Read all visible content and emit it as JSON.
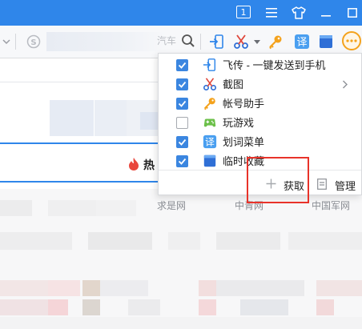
{
  "titlebar": {
    "badge_count": "1",
    "menu_icon": "hamburger-icon",
    "skin_icon": "tshirt-icon",
    "minimize_icon": "minimize-icon",
    "maximize_icon": "maximize-icon"
  },
  "toolbar": {
    "search_partial_text": "汽车",
    "tools": [
      "send-to-phone-icon",
      "screenshot-scissors-icon",
      "key-icon",
      "translate-icon",
      "favorites-icon",
      "more-icon"
    ]
  },
  "page": {
    "hot_label": "热",
    "links": [
      "求是网",
      "中青网",
      "中国军网"
    ]
  },
  "menu": {
    "items": [
      {
        "label": "飞传 - 一键发送到手机",
        "checked": true,
        "icon": "send-to-phone-icon"
      },
      {
        "label": "截图",
        "checked": true,
        "icon": "scissors-icon",
        "has_submenu": true
      },
      {
        "label": "帐号助手",
        "checked": true,
        "icon": "key-icon"
      },
      {
        "label": "玩游戏",
        "checked": false,
        "icon": "gamepad-icon"
      },
      {
        "label": "划词菜单",
        "checked": true,
        "icon": "translate-icon"
      },
      {
        "label": "临时收藏",
        "checked": true,
        "icon": "collection-icon"
      }
    ],
    "footer": {
      "acquire_label": "获取",
      "manage_label": "管理"
    }
  },
  "colors": {
    "titlebar": "#2f86ea",
    "checkbox": "#3b86e0",
    "highlight": "#e8332a",
    "more_button": "#f4a21c"
  }
}
